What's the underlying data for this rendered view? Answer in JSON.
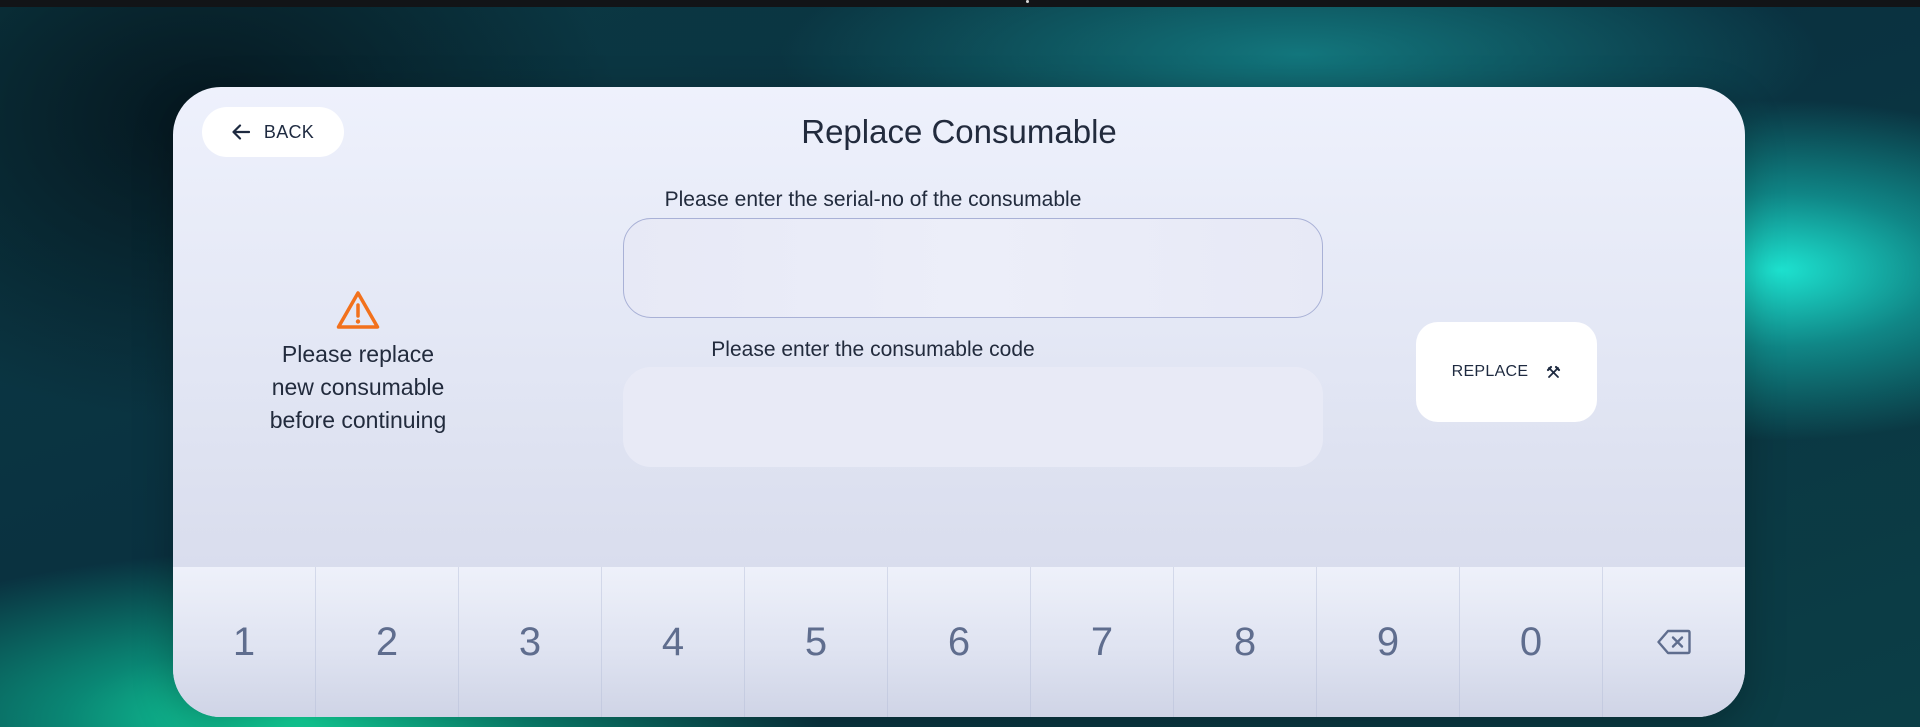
{
  "header": {
    "back_label": "BACK",
    "title": "Replace Consumable"
  },
  "warning": {
    "icon": "warning-triangle-icon",
    "icon_color": "#f2711c",
    "line1": "Please replace",
    "line2": "new consumable",
    "line3": "before continuing"
  },
  "serial": {
    "label": "Please enter the serial-no of the consumable",
    "value": "",
    "placeholder": ""
  },
  "code": {
    "label": "Please enter the consumable code",
    "value": "",
    "placeholder": ""
  },
  "replace_button": {
    "label": "REPLACE",
    "icon": "tools-icon"
  },
  "keypad": {
    "keys": [
      "1",
      "2",
      "3",
      "4",
      "5",
      "6",
      "7",
      "8",
      "9",
      "0"
    ],
    "backspace_icon": "backspace-icon"
  },
  "colors": {
    "accent": "#f2711c",
    "text": "#222b3d",
    "key_text": "#5f6d8e"
  }
}
